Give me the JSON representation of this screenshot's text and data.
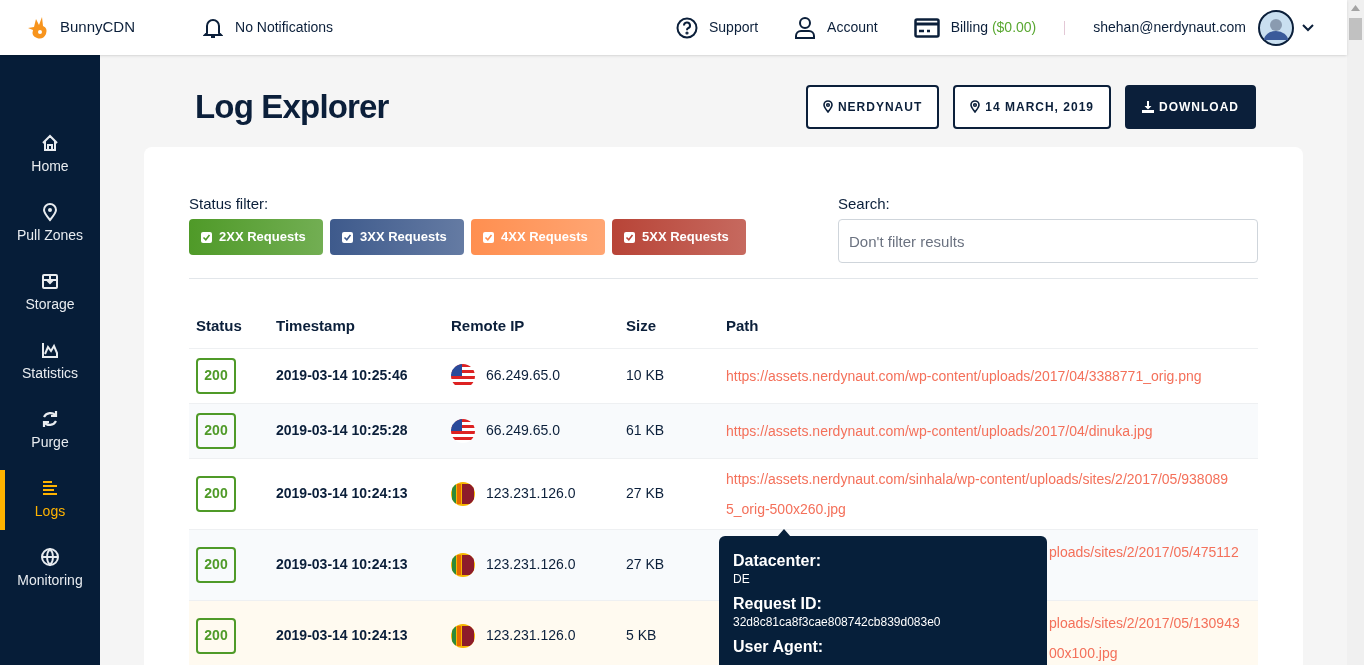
{
  "brand": "BunnyCDN",
  "notifications": "No Notifications",
  "top_nav": [
    {
      "kind": "support",
      "label": "Support"
    },
    {
      "kind": "account",
      "label": "Account"
    },
    {
      "kind": "billing",
      "label": "Billing",
      "amount": "($0.00)"
    }
  ],
  "user_email": "shehan@nerdynaut.com",
  "sidebar": [
    {
      "kind": "home",
      "label": "Home",
      "selected": false
    },
    {
      "kind": "pin",
      "label": "Pull Zones",
      "selected": false
    },
    {
      "kind": "box",
      "label": "Storage",
      "selected": false
    },
    {
      "kind": "chart",
      "label": "Statistics",
      "selected": false
    },
    {
      "kind": "refresh",
      "label": "Purge",
      "selected": false
    },
    {
      "kind": "lines",
      "label": "Logs",
      "selected": true
    },
    {
      "kind": "globe",
      "label": "Monitoring",
      "selected": false
    }
  ],
  "page_title": "Log Explorer",
  "header_buttons": [
    {
      "kind": "outline",
      "label": "NERDYNAUT"
    },
    {
      "kind": "outline",
      "label": "14 MARCH, 2019"
    },
    {
      "kind": "download",
      "label": "DOWNLOAD"
    }
  ],
  "status_filter": {
    "label": "Status filter:",
    "options": [
      {
        "label": "2XX Requests",
        "checked": true,
        "color": "#4f9a28"
      },
      {
        "label": "3XX Requests",
        "checked": true,
        "color": "#3e5a8c"
      },
      {
        "label": "4XX Requests",
        "checked": true,
        "color": "#ff8f50"
      },
      {
        "label": "5XX Requests",
        "checked": true,
        "color": "#b84437"
      }
    ]
  },
  "search": {
    "label": "Search:",
    "placeholder": "Don't filter results"
  },
  "table": {
    "columns": [
      "Status",
      "Timestamp",
      "Remote IP",
      "Size",
      "Path"
    ],
    "rows": [
      {
        "status": "200",
        "timestamp": "2019-03-14 10:25:46",
        "kind": "us",
        "ip": "66.249.65.0",
        "size": "10 KB",
        "path": [
          "https://assets.nerdynaut.com/wp-content/uploads/2017/04/3388771_orig.png"
        ],
        "hovered": false,
        "behind_tooltip": false
      },
      {
        "status": "200",
        "timestamp": "2019-03-14 10:25:28",
        "kind": "us",
        "ip": "66.249.65.0",
        "size": "61 KB",
        "path": [
          "https://assets.nerdynaut.com/wp-content/uploads/2017/04/dinuka.jpg"
        ],
        "hovered": false,
        "behind_tooltip": false
      },
      {
        "status": "200",
        "timestamp": "2019-03-14 10:24:13",
        "kind": "lk",
        "ip": "123.231.126.0",
        "size": "27 KB",
        "path": [
          "https://assets.nerdynaut.com/sinhala/wp-content/uploads/sites/2/2017/05/938089",
          "5_orig-500x260.jpg"
        ],
        "hovered": false,
        "behind_tooltip": false
      },
      {
        "status": "200",
        "timestamp": "2019-03-14 10:24:13",
        "kind": "lk",
        "ip": "123.231.126.0",
        "size": "27 KB",
        "path": [
          "ploads/sites/2/2017/05/475112"
        ],
        "hovered": false,
        "behind_tooltip": true
      },
      {
        "status": "200",
        "timestamp": "2019-03-14 10:24:13",
        "kind": "lk",
        "ip": "123.231.126.0",
        "size": "5 KB",
        "path": [
          "ploads/sites/2/2017/05/130943",
          "00x100.jpg"
        ],
        "hovered": true,
        "behind_tooltip": true
      }
    ]
  },
  "tooltip": [
    {
      "label": "Datacenter:",
      "value": "DE"
    },
    {
      "label": "Request ID:",
      "value": "32d8c81ca8f3cae808742cb839d083e0"
    },
    {
      "label": "User Agent:"
    }
  ]
}
